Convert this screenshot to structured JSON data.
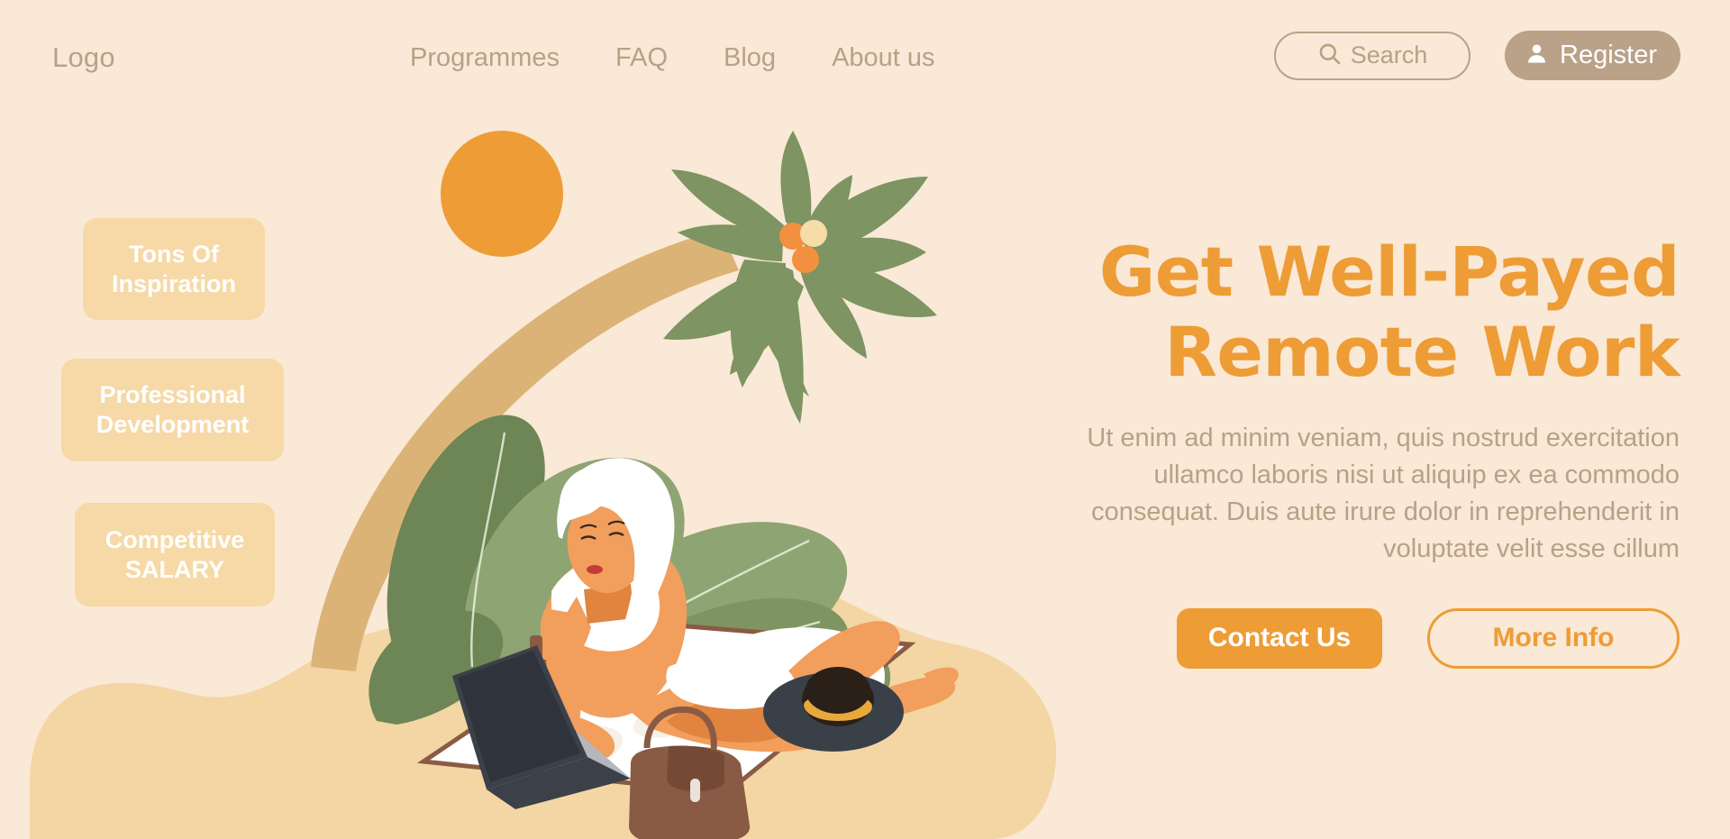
{
  "theme": {
    "background": "#F9E9D6",
    "accent_orange": "#EE9C36",
    "muted_tan": "#B8A187",
    "badge_bg": "#F6D9A7",
    "sand": "#F3D6A4",
    "trunk": "#DCB377",
    "leaf_dark": "#6E8556",
    "leaf_light": "#90A573",
    "skin": "#F29E5C",
    "skin_shadow": "#E08445",
    "laptop": "#3C4049",
    "hat_dark": "#3A4048",
    "bag_brown": "#8A5B44",
    "towel_white": "#FFFFFF"
  },
  "header": {
    "logo": "Logo",
    "nav": [
      {
        "label": "Programmes"
      },
      {
        "label": "FAQ"
      },
      {
        "label": "Blog"
      },
      {
        "label": "About us"
      }
    ],
    "search": {
      "icon": "search-icon",
      "label": "Search"
    },
    "register": {
      "icon": "user-icon",
      "label": "Register"
    }
  },
  "badges": [
    {
      "label": "Tons Of Inspiration"
    },
    {
      "label": "Professional Development"
    },
    {
      "label": "Competitive SALARY"
    }
  ],
  "hero": {
    "headline_line1": "Get Well-Payed",
    "headline_line2": "Remote Work",
    "paragraph": "Ut enim ad minim veniam, quis nostrud exercitation ullamco laboris nisi ut aliquip ex ea commodo consequat. Duis aute irure dolor in reprehenderit in voluptate velit esse cillum",
    "cta_primary": "Contact Us",
    "cta_secondary": "More Info"
  },
  "illustration": {
    "description": "Flat vector beach scene: orange sun, leaning palm tree with coconuts, tropical foliage, woman in white swimsuit lying on a towel with a laptop, bottle, sun hat and handbag on sand.",
    "elements": [
      "sun",
      "palm-tree",
      "coconuts",
      "foliage",
      "sand-blob",
      "beach-towel",
      "woman",
      "laptop",
      "bottle",
      "sun-hat",
      "handbag"
    ]
  }
}
